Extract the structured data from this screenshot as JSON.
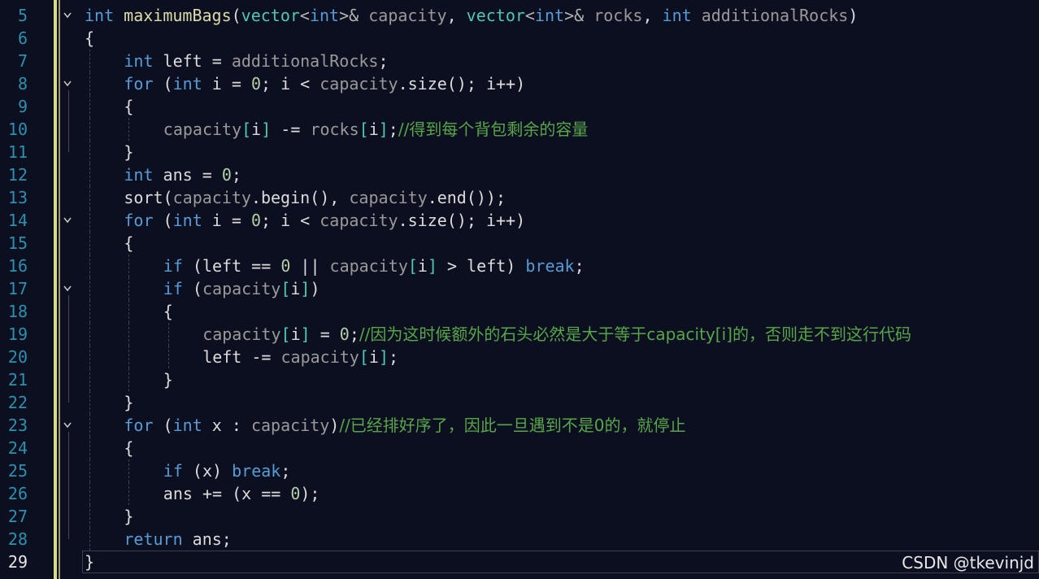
{
  "editor": {
    "current_line": 29,
    "lines": [
      {
        "n": 5,
        "fold": "v",
        "indent": 0,
        "tokens": [
          {
            "t": "int",
            "c": "kw"
          },
          {
            "t": " "
          },
          {
            "t": "maximumBags",
            "c": "fn"
          },
          {
            "t": "(",
            "c": "pn"
          },
          {
            "t": "vector",
            "c": "tp"
          },
          {
            "t": "<",
            "c": "op"
          },
          {
            "t": "int",
            "c": "kw"
          },
          {
            "t": ">&",
            "c": "op"
          },
          {
            "t": " "
          },
          {
            "t": "capacity",
            "c": "pr"
          },
          {
            "t": ", ",
            "c": "pn"
          },
          {
            "t": "vector",
            "c": "tp"
          },
          {
            "t": "<",
            "c": "op"
          },
          {
            "t": "int",
            "c": "kw"
          },
          {
            "t": ">&",
            "c": "op"
          },
          {
            "t": " "
          },
          {
            "t": "rocks",
            "c": "pr"
          },
          {
            "t": ", ",
            "c": "pn"
          },
          {
            "t": "int",
            "c": "kw"
          },
          {
            "t": " "
          },
          {
            "t": "additionalRocks",
            "c": "pr"
          },
          {
            "t": ")",
            "c": "pn"
          }
        ]
      },
      {
        "n": 6,
        "fold": "",
        "indent": 0,
        "tokens": [
          {
            "t": "{",
            "c": "pn"
          }
        ]
      },
      {
        "n": 7,
        "fold": "",
        "indent": 1,
        "tokens": [
          {
            "t": "int",
            "c": "kw"
          },
          {
            "t": " left = "
          },
          {
            "t": "additionalRocks",
            "c": "pr"
          },
          {
            "t": ";",
            "c": "pn"
          }
        ]
      },
      {
        "n": 8,
        "fold": "v",
        "indent": 1,
        "tokens": [
          {
            "t": "for",
            "c": "kw"
          },
          {
            "t": " ("
          },
          {
            "t": "int",
            "c": "kw"
          },
          {
            "t": " i = "
          },
          {
            "t": "0",
            "c": "nm"
          },
          {
            "t": "; i < "
          },
          {
            "t": "capacity",
            "c": "pr"
          },
          {
            "t": ".size(); i++)"
          }
        ]
      },
      {
        "n": 9,
        "fold": "",
        "indent": 1,
        "tokens": [
          {
            "t": "{",
            "c": "pn"
          }
        ]
      },
      {
        "n": 10,
        "fold": "",
        "indent": 2,
        "tokens": [
          {
            "t": "capacity",
            "c": "pr"
          },
          {
            "t": "[",
            "c": "tp"
          },
          {
            "t": "i"
          },
          {
            "t": "]",
            "c": "tp"
          },
          {
            "t": " -= "
          },
          {
            "t": "rocks",
            "c": "pr"
          },
          {
            "t": "[",
            "c": "tp"
          },
          {
            "t": "i"
          },
          {
            "t": "]",
            "c": "tp"
          },
          {
            "t": ";"
          },
          {
            "t": "//得到每个背包剩余的容量",
            "c": "cm"
          }
        ]
      },
      {
        "n": 11,
        "fold": "end",
        "indent": 1,
        "tokens": [
          {
            "t": "}",
            "c": "pn"
          }
        ]
      },
      {
        "n": 12,
        "fold": "",
        "indent": 1,
        "tokens": [
          {
            "t": "int",
            "c": "kw"
          },
          {
            "t": " ans = "
          },
          {
            "t": "0",
            "c": "nm"
          },
          {
            "t": ";"
          }
        ]
      },
      {
        "n": 13,
        "fold": "",
        "indent": 1,
        "tokens": [
          {
            "t": "sort("
          },
          {
            "t": "capacity",
            "c": "pr"
          },
          {
            "t": ".begin(), "
          },
          {
            "t": "capacity",
            "c": "pr"
          },
          {
            "t": ".end());"
          }
        ]
      },
      {
        "n": 14,
        "fold": "v",
        "indent": 1,
        "tokens": [
          {
            "t": "for",
            "c": "kw"
          },
          {
            "t": " ("
          },
          {
            "t": "int",
            "c": "kw"
          },
          {
            "t": " i = "
          },
          {
            "t": "0",
            "c": "nm"
          },
          {
            "t": "; i < "
          },
          {
            "t": "capacity",
            "c": "pr"
          },
          {
            "t": ".size(); i++)"
          }
        ]
      },
      {
        "n": 15,
        "fold": "",
        "indent": 1,
        "tokens": [
          {
            "t": "{",
            "c": "pn"
          }
        ]
      },
      {
        "n": 16,
        "fold": "",
        "indent": 2,
        "tokens": [
          {
            "t": "if",
            "c": "kw"
          },
          {
            "t": " (left == "
          },
          {
            "t": "0",
            "c": "nm"
          },
          {
            "t": " || "
          },
          {
            "t": "capacity",
            "c": "pr"
          },
          {
            "t": "[",
            "c": "tp"
          },
          {
            "t": "i"
          },
          {
            "t": "]",
            "c": "tp"
          },
          {
            "t": " > left) "
          },
          {
            "t": "break",
            "c": "kw"
          },
          {
            "t": ";"
          }
        ]
      },
      {
        "n": 17,
        "fold": "v",
        "indent": 2,
        "tokens": [
          {
            "t": "if",
            "c": "kw"
          },
          {
            "t": " ("
          },
          {
            "t": "capacity",
            "c": "pr"
          },
          {
            "t": "[",
            "c": "tp"
          },
          {
            "t": "i"
          },
          {
            "t": "]",
            "c": "tp"
          },
          {
            "t": ")"
          }
        ]
      },
      {
        "n": 18,
        "fold": "",
        "indent": 2,
        "tokens": [
          {
            "t": "{",
            "c": "pn"
          }
        ]
      },
      {
        "n": 19,
        "fold": "",
        "indent": 3,
        "tokens": [
          {
            "t": "capacity",
            "c": "pr"
          },
          {
            "t": "[",
            "c": "tp"
          },
          {
            "t": "i"
          },
          {
            "t": "]",
            "c": "tp"
          },
          {
            "t": " = "
          },
          {
            "t": "0",
            "c": "nm"
          },
          {
            "t": ";"
          },
          {
            "t": "//因为这时候额外的石头必然是大于等于capacity[i]的，否则走不到这行代码",
            "c": "cm"
          }
        ]
      },
      {
        "n": 20,
        "fold": "",
        "indent": 3,
        "tokens": [
          {
            "t": "left -= "
          },
          {
            "t": "capacity",
            "c": "pr"
          },
          {
            "t": "[",
            "c": "tp"
          },
          {
            "t": "i"
          },
          {
            "t": "]",
            "c": "tp"
          },
          {
            "t": ";"
          }
        ]
      },
      {
        "n": 21,
        "fold": "",
        "indent": 2,
        "tokens": [
          {
            "t": "}",
            "c": "pn"
          }
        ]
      },
      {
        "n": 22,
        "fold": "end",
        "indent": 1,
        "tokens": [
          {
            "t": "}",
            "c": "pn"
          }
        ]
      },
      {
        "n": 23,
        "fold": "v",
        "indent": 1,
        "tokens": [
          {
            "t": "for",
            "c": "kw"
          },
          {
            "t": " ("
          },
          {
            "t": "int",
            "c": "kw"
          },
          {
            "t": " x : "
          },
          {
            "t": "capacity",
            "c": "pr"
          },
          {
            "t": ")"
          },
          {
            "t": "//已经排好序了，因此一旦遇到不是0的，就停止",
            "c": "cm"
          }
        ]
      },
      {
        "n": 24,
        "fold": "",
        "indent": 1,
        "tokens": [
          {
            "t": "{",
            "c": "pn"
          }
        ]
      },
      {
        "n": 25,
        "fold": "",
        "indent": 2,
        "tokens": [
          {
            "t": "if",
            "c": "kw"
          },
          {
            "t": " (x) "
          },
          {
            "t": "break",
            "c": "kw"
          },
          {
            "t": ";"
          }
        ]
      },
      {
        "n": 26,
        "fold": "",
        "indent": 2,
        "tokens": [
          {
            "t": "ans += (x == "
          },
          {
            "t": "0",
            "c": "nm"
          },
          {
            "t": ");"
          }
        ]
      },
      {
        "n": 27,
        "fold": "",
        "indent": 1,
        "tokens": [
          {
            "t": "}",
            "c": "pn"
          }
        ]
      },
      {
        "n": 28,
        "fold": "end",
        "indent": 1,
        "tokens": [
          {
            "t": "return",
            "c": "kw"
          },
          {
            "t": " ans;"
          }
        ]
      },
      {
        "n": 29,
        "fold": "",
        "indent": 0,
        "tokens": [
          {
            "t": "}",
            "c": "pn"
          }
        ]
      }
    ]
  },
  "watermark": "CSDN @tkevinjd",
  "colors": {
    "background": "#0c0f1f",
    "keyword": "#569cd6",
    "type": "#4ec9b0",
    "comment": "#57a64a",
    "number": "#b5cea8",
    "line_number": "#2b91af",
    "change_bar": "#d9d98c"
  },
  "icons": {
    "fold_expanded": "chevron-down-icon"
  }
}
